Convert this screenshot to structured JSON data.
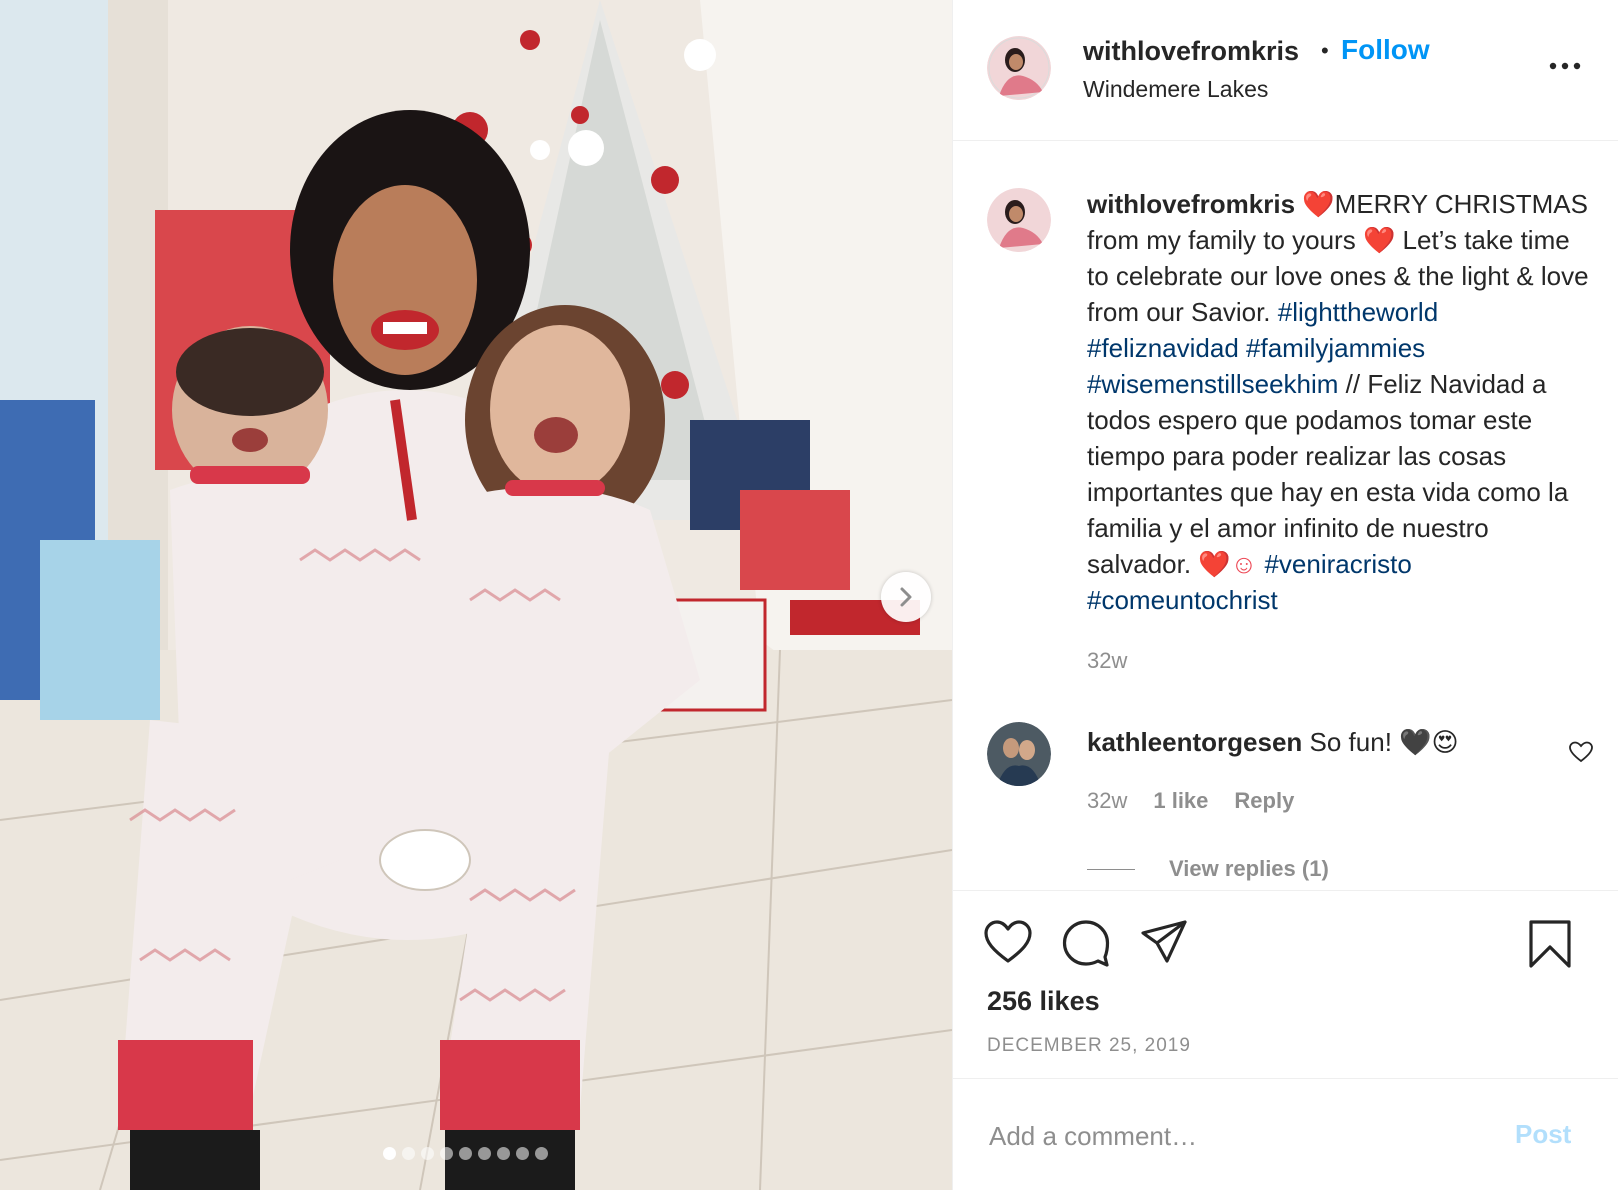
{
  "post": {
    "author": "withlovefromkris",
    "follow_label": "Follow",
    "separator": "•",
    "location": "Windemere Lakes",
    "more_icon": "more-options-icon"
  },
  "photo": {
    "next_icon": "chevron-right-icon",
    "carousel_count": 9,
    "carousel_active": 1
  },
  "caption": {
    "username": "withlovefromkris",
    "heart": "❤️",
    "text_1": "MERRY CHRISTMAS from my family to yours ",
    "text_2": " Let’s take time to celebrate our love ones & the light & love from our Savior. ",
    "hashtags_1": [
      "#lighttheworld",
      "#feliznavidad",
      "#familyjammies",
      "#wisemenstillseekhim"
    ],
    "text_3": "// Feliz Navidad a todos espero que podamos tomar este tiempo para poder realizar las cosas importantes que hay en esta vida como la familia y el amor infinito de nuestro salvador. ",
    "emoji_end": "❤️☺",
    "hashtags_2": [
      "#veniracristo",
      "#comeuntochrist"
    ],
    "age": "32w"
  },
  "comment": {
    "username": "kathleentorgesen",
    "text": "So fun! 🖤😍",
    "age": "32w",
    "likes": "1 like",
    "reply_label": "Reply",
    "view_replies": "View replies (1)"
  },
  "actions": {
    "like_icon": "heart-icon",
    "comment_icon": "comment-icon",
    "share_icon": "share-icon",
    "save_icon": "bookmark-icon"
  },
  "likes_text": "256 likes",
  "date": "DECEMBER 25, 2019",
  "add_comment": {
    "placeholder": "Add a comment…",
    "post_label": "Post"
  },
  "colors": {
    "accent": "#0095f6",
    "hashtag": "#00376b",
    "muted": "#8e8e8e",
    "post_disabled": "#b2dffc"
  }
}
